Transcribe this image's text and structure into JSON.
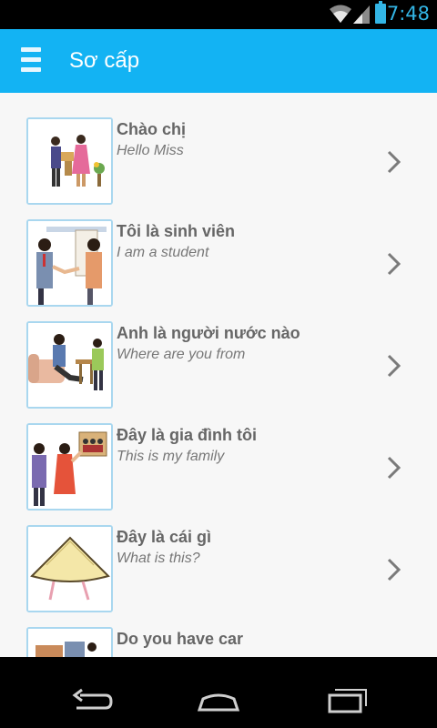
{
  "status_bar": {
    "time": "7:48",
    "icons": [
      "wifi-icon",
      "signal-icon",
      "battery-icon"
    ],
    "accent_color": "#33b5e5"
  },
  "action_bar": {
    "title": "Sơ cấp",
    "menu_icon": "hamburger-menu-icon",
    "background": "#13b3f3"
  },
  "lessons": [
    {
      "title": "Chào chị",
      "subtitle": "Hello Miss",
      "icon": "chevron-right-icon"
    },
    {
      "title": "Tôi là sinh viên",
      "subtitle": "I am a student",
      "icon": "chevron-right-icon"
    },
    {
      "title": "Anh là người nước nào",
      "subtitle": "Where are you from",
      "icon": "chevron-right-icon"
    },
    {
      "title": "Đây là gia đình tôi",
      "subtitle": "This is my family",
      "icon": "chevron-right-icon"
    },
    {
      "title": "Đây là cái gì",
      "subtitle": "What is this?",
      "icon": "chevron-right-icon"
    },
    {
      "title": "Do you have car",
      "subtitle": "",
      "icon": "chevron-right-icon"
    }
  ],
  "nav_bar": {
    "icons": [
      "back-icon",
      "home-icon",
      "recent-apps-icon"
    ]
  }
}
